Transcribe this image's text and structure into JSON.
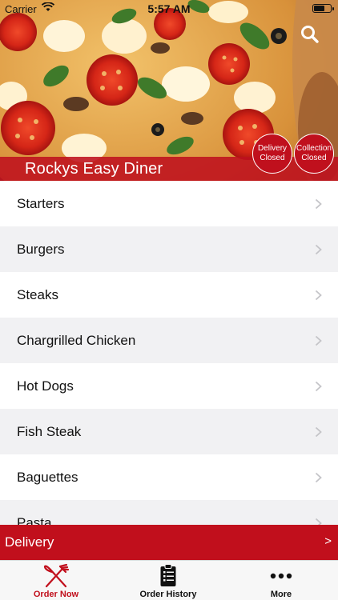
{
  "status_bar": {
    "carrier": "Carrier",
    "time": "5:57 AM",
    "battery_level": 0.6
  },
  "header": {
    "restaurant_name": "Rockys Easy Diner",
    "delivery_badge": {
      "line1": "Delivery",
      "line2": "Closed"
    },
    "collection_badge": {
      "line1": "Collection",
      "line2": "Closed"
    }
  },
  "menu": {
    "items": [
      {
        "label": "Starters"
      },
      {
        "label": "Burgers"
      },
      {
        "label": "Steaks"
      },
      {
        "label": "Chargrilled Chicken"
      },
      {
        "label": "Hot Dogs"
      },
      {
        "label": "Fish Steak"
      },
      {
        "label": "Baguettes"
      },
      {
        "label": "Pasta"
      }
    ]
  },
  "delivery_bar": {
    "label": "Delivery",
    "arrow": ">"
  },
  "tab_bar": {
    "tabs": [
      {
        "label": "Order Now",
        "icon": "fork-knife-icon",
        "active": true
      },
      {
        "label": "Order History",
        "icon": "clipboard-list-icon",
        "active": false
      },
      {
        "label": "More",
        "icon": "more-dots-icon",
        "active": false
      }
    ]
  },
  "colors": {
    "brand_red": "#c10f1c",
    "alt_row": "#f1f1f3"
  }
}
